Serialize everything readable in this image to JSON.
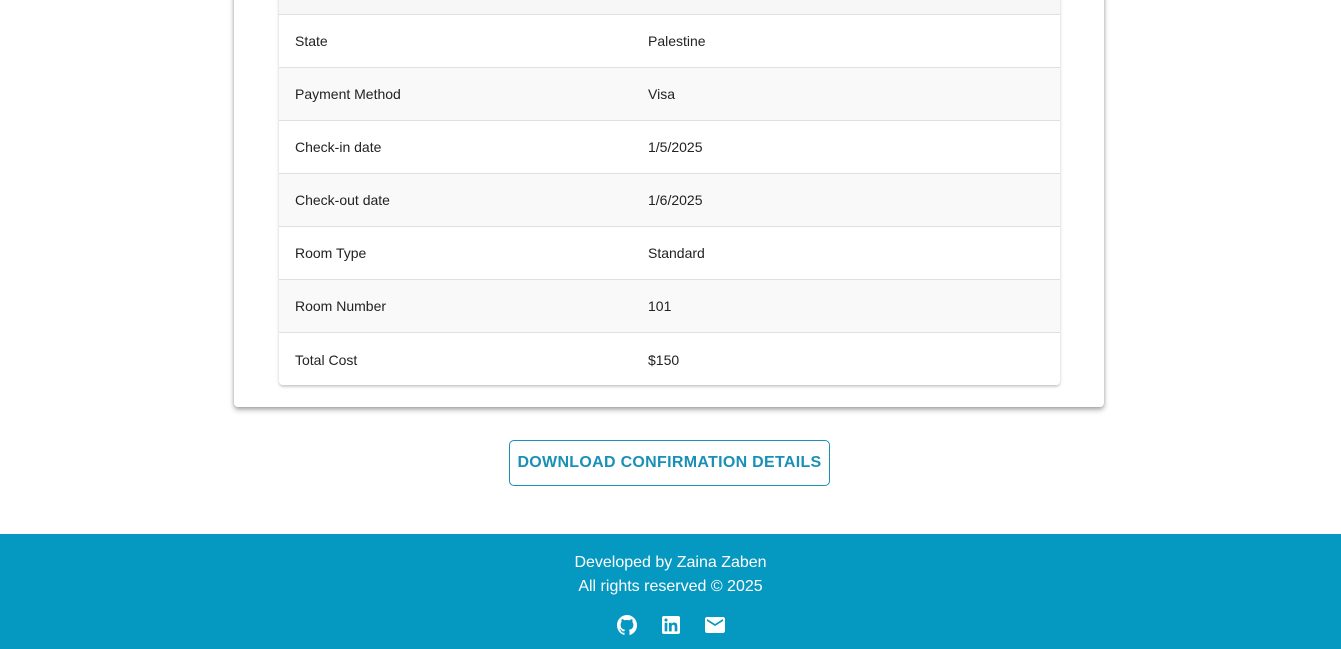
{
  "booking_details": {
    "rows": [
      {
        "label": "State",
        "value": "Palestine"
      },
      {
        "label": "Payment Method",
        "value": "Visa"
      },
      {
        "label": "Check-in date",
        "value": "1/5/2025"
      },
      {
        "label": "Check-out date",
        "value": "1/6/2025"
      },
      {
        "label": "Room Type",
        "value": "Standard"
      },
      {
        "label": "Room Number",
        "value": "101"
      },
      {
        "label": "Total Cost",
        "value": "$150"
      }
    ]
  },
  "actions": {
    "download_label": "DOWNLOAD CONFIRMATION DETAILS"
  },
  "footer": {
    "developer_text": "Developed by Zaina Zaben",
    "copyright_text": "All rights reserved © 2025",
    "icons": [
      "github-icon",
      "linkedin-icon",
      "email-icon"
    ]
  },
  "colors": {
    "accent": "#1a8fb8",
    "footer_bg": "#0598c0"
  }
}
